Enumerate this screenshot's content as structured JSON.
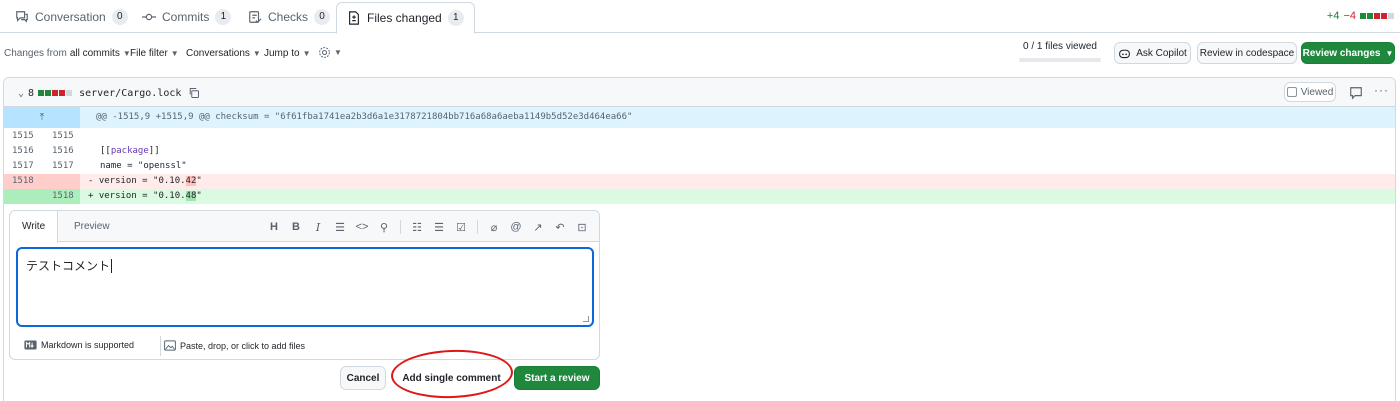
{
  "tabs": [
    {
      "label": "Conversation",
      "count": "0"
    },
    {
      "label": "Commits",
      "count": "1"
    },
    {
      "label": "Checks",
      "count": "0"
    },
    {
      "label": "Files changed",
      "count": "1"
    }
  ],
  "diffstat": {
    "additions": "+4",
    "deletions": "−4"
  },
  "toolbar": {
    "changes_from_prefix": "Changes from",
    "changes_from_value": "all commits",
    "file_filter": "File filter",
    "conversations": "Conversations",
    "jump_to": "Jump to",
    "files_viewed": "0 / 1 files viewed",
    "ask_copilot": "Ask Copilot",
    "review_codespace": "Review in codespace",
    "review_changes": "Review changes"
  },
  "file": {
    "change_count": "8",
    "path": "server/Cargo.lock",
    "viewed_label": "Viewed",
    "hunk_header": "@@ -1515,9 +1515,9 @@ checksum = \"6f61fba1741ea2b3d6a1e3178721804bb716a68a6aeba1149b5d52e3d464ea66\"",
    "lines": {
      "r1": {
        "old": "1515",
        "new": "1515"
      },
      "r2": {
        "old": "1516",
        "new": "1516",
        "pre": "[[",
        "kw": "package",
        "post": "]]"
      },
      "r3": {
        "old": "1517",
        "new": "1517",
        "text": "name = \"openssl\""
      },
      "r4": {
        "old": "1518",
        "new": "",
        "pre": "- version = \"0.10.",
        "hl": "42",
        "post": "\""
      },
      "r5": {
        "old": "",
        "new": "1518",
        "pre": "+ version = \"0.10.",
        "hl": "48",
        "post": "\""
      }
    }
  },
  "comment": {
    "write_tab": "Write",
    "preview_tab": "Preview",
    "text": "テストコメント",
    "markdown_note": "Markdown is supported",
    "attach_note": "Paste, drop, or click to add files"
  },
  "actions": {
    "cancel": "Cancel",
    "add_single": "Add single comment",
    "start_review": "Start a review"
  },
  "colors": {
    "primary_green": "#1f883d",
    "focus_blue": "#0969da",
    "annotation_red": "#e01515"
  }
}
